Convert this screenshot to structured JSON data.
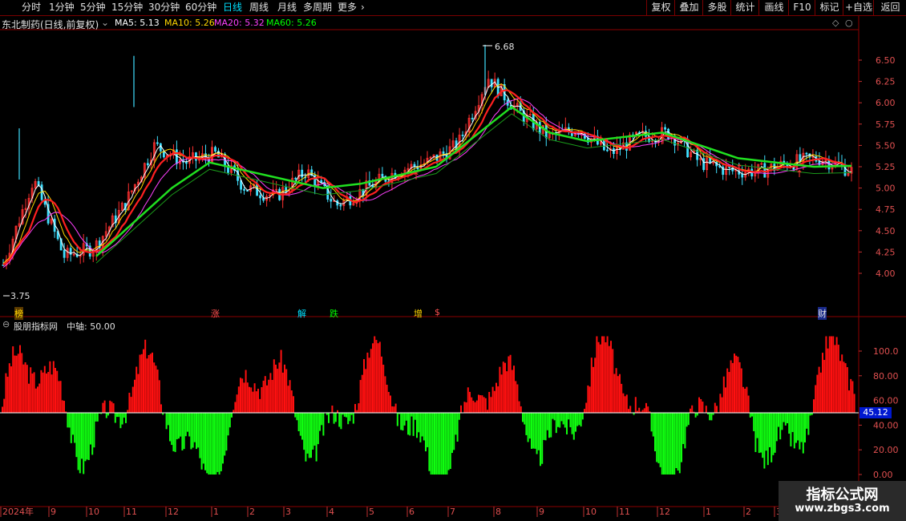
{
  "toolbar": {
    "periods": [
      "分时",
      "1分钟",
      "5分钟",
      "15分钟",
      "30分钟",
      "60分钟",
      "日线",
      "周线",
      "月线",
      "多周期",
      "更多"
    ],
    "active_period": "日线",
    "actions": [
      "复权",
      "叠加",
      "多股",
      "统计",
      "画线",
      "F10",
      "标记",
      "+自选",
      "返回"
    ]
  },
  "main_header": {
    "stock": "东北制药(日线,前复权)",
    "ma_labels": [
      "MA5: 5.13",
      "MA10: 5.26",
      "MA20: 5.32",
      "MA60: 5.26"
    ]
  },
  "price_axis": [
    "6.50",
    "6.25",
    "6.00",
    "5.75",
    "5.50",
    "5.25",
    "5.00",
    "4.75",
    "4.50",
    "4.25",
    "4.00"
  ],
  "annotations": {
    "high": "6.68",
    "low": "3.75"
  },
  "signals": [
    "榜",
    "涨",
    "解",
    "跌",
    "增",
    "$",
    "财"
  ],
  "indicator": {
    "title": "股朋指标网",
    "axis_label": "中轴: 50.00",
    "axis_values": [
      "100.0",
      "80.00",
      "60.00",
      "40.00",
      "20.00",
      "0.00"
    ],
    "current_value": "45.12"
  },
  "time_axis": [
    "2024年",
    "9",
    "10",
    "11",
    "12",
    "1",
    "2",
    "3",
    "4",
    "5",
    "6",
    "7",
    "8",
    "9",
    "10",
    "11",
    "12",
    "1",
    "2",
    "3"
  ],
  "colors": {
    "up": "#ff2020",
    "down": "#00ff00",
    "ma5": "#ffffff",
    "ma10": "#ffd700",
    "ma20": "#ff40ff",
    "ma60": "#00ff00",
    "grid": "#8b0000"
  },
  "watermark": {
    "title": "指标公式网",
    "url": "www.zbgs3.com"
  },
  "chart_data": {
    "type": "line",
    "title": "东北制药(日线,前复权)",
    "y_range": [
      3.75,
      6.68
    ],
    "series": [
      {
        "name": "MA5",
        "values": [
          4.1,
          5.1,
          4.2,
          4.3,
          4.8,
          5.5,
          5.3,
          5.4,
          5.0,
          4.9,
          5.2,
          4.8,
          5.0,
          5.2,
          5.3,
          5.5,
          6.3,
          5.9,
          5.6,
          5.7,
          5.4,
          5.6,
          5.65,
          5.3,
          5.2,
          5.2,
          5.3,
          5.35,
          5.2
        ]
      },
      {
        "name": "MA60",
        "values": [
          4.2,
          4.6,
          5.0,
          5.3,
          5.2,
          5.1,
          5.0,
          5.05,
          5.15,
          5.25,
          5.6,
          5.95,
          5.65,
          5.55,
          5.6,
          5.65,
          5.5,
          5.35,
          5.3,
          5.25,
          5.26
        ]
      }
    ],
    "oscillator": {
      "center": 50,
      "range": [
        0,
        115
      ],
      "last": 45.12
    }
  }
}
